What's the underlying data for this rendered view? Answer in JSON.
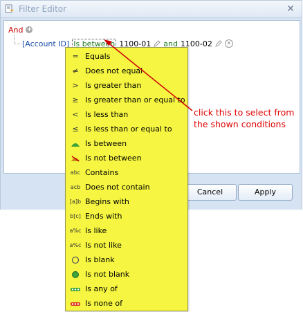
{
  "window": {
    "title": "Filter Editor"
  },
  "tree": {
    "group_operator": "And",
    "condition": {
      "field": "[Account ID]",
      "operator": "Is between",
      "value1": "1100-01",
      "joiner": "and",
      "value2": "1100-02"
    }
  },
  "buttons": {
    "cancel": "Cancel",
    "apply": "Apply"
  },
  "conditions_menu": [
    {
      "label": "Equals",
      "icon": "equals-icon"
    },
    {
      "label": "Does not equal",
      "icon": "not-equal-icon"
    },
    {
      "label": "Is greater than",
      "icon": "greater-than-icon"
    },
    {
      "label": "Is greater than or equal to",
      "icon": "greater-equal-icon"
    },
    {
      "label": "Is less than",
      "icon": "less-than-icon"
    },
    {
      "label": "Is less than or equal to",
      "icon": "less-equal-icon"
    },
    {
      "label": "Is between",
      "icon": "between-icon"
    },
    {
      "label": "Is not between",
      "icon": "not-between-icon"
    },
    {
      "label": "Contains",
      "icon": "contains-icon"
    },
    {
      "label": "Does not contain",
      "icon": "not-contain-icon"
    },
    {
      "label": "Begins with",
      "icon": "begins-with-icon"
    },
    {
      "label": "Ends with",
      "icon": "ends-with-icon"
    },
    {
      "label": "Is like",
      "icon": "like-icon"
    },
    {
      "label": "Is not like",
      "icon": "not-like-icon"
    },
    {
      "label": "Is blank",
      "icon": "blank-icon"
    },
    {
      "label": "Is not blank",
      "icon": "not-blank-icon"
    },
    {
      "label": "Is any of",
      "icon": "any-of-icon"
    },
    {
      "label": "Is none of",
      "icon": "none-of-icon"
    }
  ],
  "annotation": {
    "line1": "click this to select from",
    "line2": "the shown conditions"
  },
  "colors": {
    "menu_bg": "#f5f542",
    "annotation": "#e00000",
    "group_operator": "#c80000",
    "field": "#1a4ca7",
    "operator": "#1d7a1d"
  }
}
